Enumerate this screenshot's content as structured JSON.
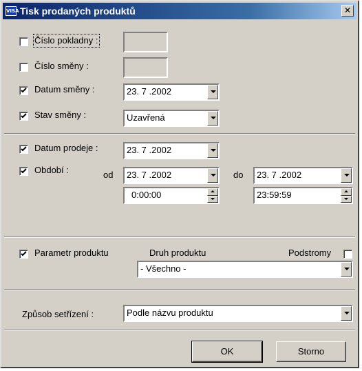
{
  "window": {
    "title": "Tisk prodaných produktů",
    "icon_text": "VISA",
    "close_label": "✕"
  },
  "top_section": {
    "cislo_pokladny": {
      "label": "Číslo pokladny :",
      "checked": false,
      "value": ""
    },
    "cislo_smeny": {
      "label": "Číslo směny :",
      "checked": false,
      "value": ""
    },
    "datum_smeny": {
      "label": "Datum směny :",
      "checked": true,
      "value": "23. 7 .2002"
    },
    "stav_smeny": {
      "label": "Stav směny :",
      "checked": true,
      "value": "Uzavřená"
    }
  },
  "middle_section": {
    "datum_prodeje": {
      "label": "Datum prodeje :",
      "checked": true,
      "value": "23. 7 .2002"
    },
    "obdobi": {
      "label": "Období :",
      "checked": true,
      "od_label": "od",
      "do_label": "do",
      "od_date": "23. 7 .2002",
      "od_time": "0:00:00",
      "do_date": "23. 7 .2002",
      "do_time": "23:59:59"
    }
  },
  "product_section": {
    "parametr_label": "Parametr produktu",
    "parametr_checked": true,
    "druh_label": "Druh produktu",
    "podstromy_label": "Podstromy",
    "podstromy_checked": false,
    "druh_value": "- Všechno -"
  },
  "sort_section": {
    "label": "Způsob setřízení :",
    "value": "Podle názvu produktu"
  },
  "buttons": {
    "ok": "OK",
    "storno": "Storno"
  }
}
